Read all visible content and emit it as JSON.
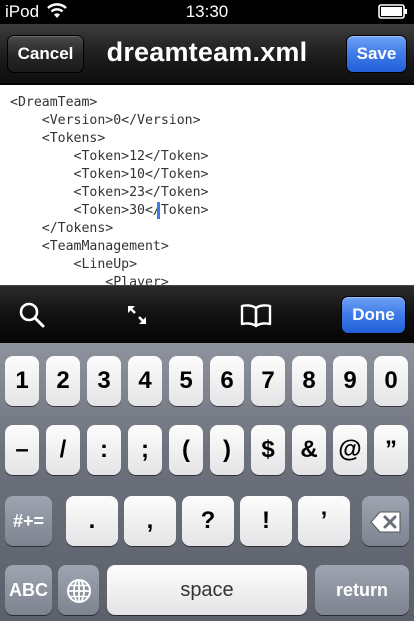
{
  "status_bar": {
    "carrier": "iPod",
    "time": "13:30"
  },
  "nav_bar": {
    "title": "dreamteam.xml",
    "cancel_label": "Cancel",
    "save_label": "Save"
  },
  "editor": {
    "lines": [
      "<DreamTeam>",
      "    <Version>0</Version>",
      "    <Tokens>",
      "        <Token>12</Token>",
      "        <Token>10</Token>",
      "        <Token>23</Token>",
      "        <Token>30</Token>",
      "    </Tokens>",
      "    <TeamManagement>",
      "        <LineUp>",
      "            <Player>"
    ]
  },
  "accessory_bar": {
    "icons": [
      "search-icon",
      "expand-icon",
      "book-icon"
    ],
    "done_label": "Done"
  },
  "keyboard": {
    "row1": [
      "1",
      "2",
      "3",
      "4",
      "5",
      "6",
      "7",
      "8",
      "9",
      "0"
    ],
    "row2": [
      "–",
      "/",
      ":",
      ";",
      "(",
      ")",
      "$",
      "&",
      "@",
      "”"
    ],
    "row3_mode": "#+=",
    "row3": [
      ".",
      ",",
      "?",
      "!",
      "’"
    ],
    "abc_label": "ABC",
    "space_label": "space",
    "return_label": "return",
    "icons": [
      "delete-icon",
      "globe-icon"
    ]
  }
}
